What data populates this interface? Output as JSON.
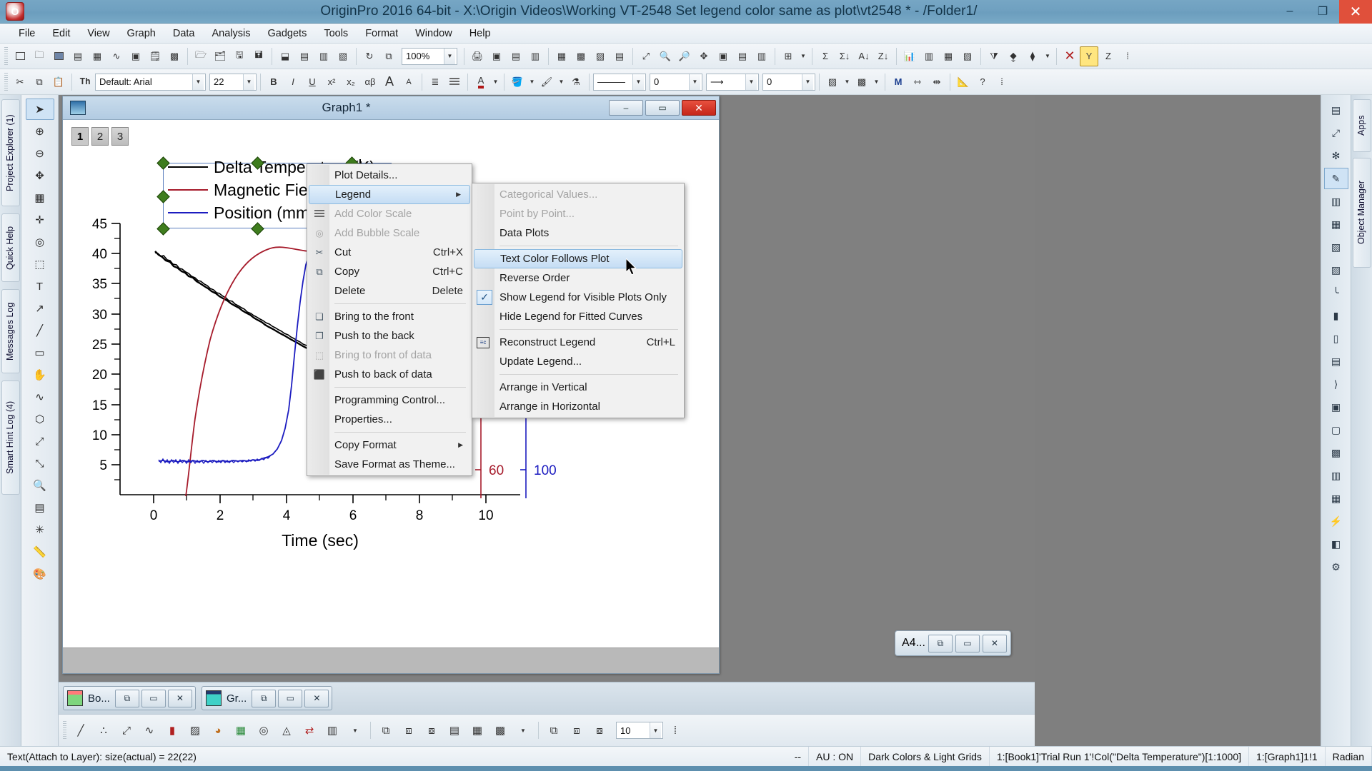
{
  "window": {
    "title": "OriginPro 2016 64-bit - X:\\Origin Videos\\Working VT-2548 Set legend color same as plot\\vt2548 * - /Folder1/",
    "minimize_label": "–",
    "maximize_label": "❐",
    "close_label": "✕",
    "app_icon": "origin-logo-icon"
  },
  "menubar": {
    "items": [
      "File",
      "Edit",
      "View",
      "Graph",
      "Data",
      "Analysis",
      "Gadgets",
      "Tools",
      "Format",
      "Window",
      "Help"
    ]
  },
  "toolbar_top": {
    "zoom_value": "100%",
    "icons": [
      "new-project-icon",
      "open-icon",
      "open-excel-icon",
      "import-icon",
      "import-wizard-icon",
      "save-project-icon",
      "save-template-icon",
      "print-icon",
      "print-preview-icon",
      "import-ascii-icon",
      "import-wizard2-icon",
      "import-db-icon",
      "refresh-icon",
      "rescale-icon",
      "new-layer-icon",
      "extract-icon",
      "merge-icon",
      "layer-manager-icon",
      "zoom-in-icon",
      "zoom-out-icon",
      "new-graph-icon",
      "new-matrix-icon",
      "new-excel-icon",
      "sigma-icon",
      "stat-icon",
      "sort-icon",
      "column-chart-icon",
      "bar-icon",
      "area-icon",
      "filter-icon",
      "clear-filter-icon",
      "cancel-icon",
      "yellow-y-icon",
      "z-icon"
    ]
  },
  "toolbar_format": {
    "font_name": "Default: Arial",
    "font_size": "22",
    "bold_label": "B",
    "italic_label": "I",
    "underline_label": "U",
    "superscript_label": "x²",
    "subscript_label": "x₂",
    "greek_label": "αβ",
    "increase_font_label": "A",
    "decrease_font_label": "A",
    "line_width_value": "0",
    "line_width_value2": "0",
    "units_label": "M",
    "icons": [
      "cut-icon",
      "copy-icon",
      "paste-icon",
      "font-icon",
      "align-icon",
      "columns-icon",
      "font-color-icon",
      "fill-color-icon",
      "pattern-color-icon",
      "highlight-icon",
      "eyedropper-icon",
      "line-style-icon",
      "arrow-style-icon",
      "hatch-icon",
      "measure-icon",
      "help-icon"
    ]
  },
  "left_dock": {
    "tabs": [
      "Project Explorer (1)",
      "Quick Help",
      "Messages Log",
      "Smart Hint Log (4)"
    ]
  },
  "right_dock": {
    "tabs": [
      "Apps",
      "Object Manager"
    ]
  },
  "graph_window": {
    "title": "Graph1 *",
    "icon": "graph-window-icon",
    "minimize_label": "–",
    "restore_label": "▭",
    "close_label": "✕",
    "layer_tabs": [
      "1",
      "2",
      "3"
    ]
  },
  "chart_data": {
    "type": "line",
    "title": "",
    "xlabel": "Time (sec)",
    "ylabel": "",
    "xlim": [
      -0.6,
      11.2
    ],
    "ylim": [
      3.2,
      46.5
    ],
    "xticks": [
      0,
      2,
      4,
      6,
      8,
      10
    ],
    "yticks": [
      5,
      10,
      15,
      20,
      25,
      30,
      35,
      40,
      45
    ],
    "grid": false,
    "legend_position": "top-center",
    "extra_right_axes": [
      {
        "label": "60",
        "color": "#a61b2b"
      },
      {
        "label": "100",
        "color": "#1c1cc0"
      }
    ],
    "series": [
      {
        "name": "Delta Temperature (K)",
        "color": "#000000",
        "unit": "K",
        "description": "Noisy monotonically decreasing curve from ~40 at t=0.6 to ~15 at t=10",
        "x": [
          0.6,
          1.0,
          1.5,
          2.0,
          2.5,
          3.0,
          3.5,
          4.0,
          4.5,
          5.0,
          5.5,
          6.0,
          6.5,
          7.0,
          7.5,
          8.0,
          8.5,
          9.0,
          9.5,
          10.0
        ],
        "y": [
          40.2,
          38.6,
          36.5,
          34.6,
          32.7,
          31.0,
          29.5,
          28.0,
          26.6,
          25.4,
          24.2,
          23.0,
          22.0,
          21.0,
          20.0,
          19.0,
          18.1,
          17.2,
          16.2,
          15.3
        ]
      },
      {
        "name": "Magnetic Field (G)",
        "color": "#a61b2b",
        "unit": "G",
        "description": "Exponential rise saturating at ~40.5",
        "x": [
          1.0,
          1.3,
          1.6,
          2.0,
          2.4,
          2.8,
          3.2,
          3.6,
          4.0,
          4.5,
          5.0,
          6.0,
          7.0,
          8.0,
          9.0,
          10.0
        ],
        "y": [
          4.0,
          9.0,
          15.0,
          22.0,
          27.5,
          31.5,
          34.5,
          36.8,
          38.3,
          39.6,
          40.1,
          40.5,
          40.5,
          40.5,
          40.5,
          40.5
        ]
      },
      {
        "name": "Position (mm)",
        "color": "#1c1cc0",
        "unit": "mm",
        "description": "Flat noisy baseline near 6 until t~3.5, then rises to peak ~41.5 at t=4.4, then falls",
        "x": [
          0.7,
          1.2,
          1.8,
          2.4,
          3.0,
          3.3,
          3.6,
          3.8,
          4.0,
          4.2,
          4.4,
          4.6,
          4.8,
          5.0,
          5.2,
          5.4,
          5.6
        ],
        "y": [
          6.1,
          6.0,
          6.2,
          6.1,
          6.6,
          7.6,
          10.5,
          15.0,
          22.5,
          33.0,
          41.3,
          41.0,
          38.0,
          31.0,
          25.5,
          22.0,
          21.5
        ]
      }
    ]
  },
  "legend": {
    "entries": [
      {
        "label": "Delta Temperature (K)",
        "color": "#000000"
      },
      {
        "label": "Magnetic Field (G)",
        "color": "#a61b2b"
      },
      {
        "label": "Position (mm)",
        "color": "#1c1cc0"
      }
    ]
  },
  "context_menu": {
    "items": [
      {
        "label": "Plot Details...",
        "icon": "",
        "shortcut": "",
        "disabled": false,
        "submenu": false,
        "highlighted": false
      },
      {
        "label": "Legend",
        "icon": "",
        "shortcut": "",
        "disabled": false,
        "submenu": true,
        "highlighted": true
      },
      {
        "label": "Add Color Scale",
        "icon": "color-scale-icon",
        "shortcut": "",
        "disabled": true,
        "submenu": false,
        "highlighted": false
      },
      {
        "label": "Add Bubble Scale",
        "icon": "bubble-scale-icon",
        "shortcut": "",
        "disabled": true,
        "submenu": false,
        "highlighted": false
      },
      {
        "label": "Cut",
        "icon": "scissors-icon",
        "shortcut": "Ctrl+X",
        "disabled": false,
        "submenu": false,
        "highlighted": false
      },
      {
        "label": "Copy",
        "icon": "copy-icon",
        "shortcut": "Ctrl+C",
        "disabled": false,
        "submenu": false,
        "highlighted": false
      },
      {
        "label": "Delete",
        "icon": "",
        "shortcut": "Delete",
        "disabled": false,
        "submenu": false,
        "highlighted": false
      },
      {
        "separator": true
      },
      {
        "label": "Bring to the front",
        "icon": "bring-front-icon",
        "shortcut": "",
        "disabled": false,
        "submenu": false,
        "highlighted": false
      },
      {
        "label": "Push to the back",
        "icon": "push-back-icon",
        "shortcut": "",
        "disabled": false,
        "submenu": false,
        "highlighted": false
      },
      {
        "label": "Bring to front of data",
        "icon": "bring-front-data-icon",
        "shortcut": "",
        "disabled": true,
        "submenu": false,
        "highlighted": false
      },
      {
        "label": "Push to back of data",
        "icon": "push-back-data-icon",
        "shortcut": "",
        "disabled": false,
        "submenu": false,
        "highlighted": false
      },
      {
        "separator": true
      },
      {
        "label": "Programming Control...",
        "icon": "",
        "shortcut": "",
        "disabled": false,
        "submenu": false,
        "highlighted": false
      },
      {
        "label": "Properties...",
        "icon": "",
        "shortcut": "",
        "disabled": false,
        "submenu": false,
        "highlighted": false
      },
      {
        "separator": true
      },
      {
        "label": "Copy Format",
        "icon": "",
        "shortcut": "",
        "disabled": false,
        "submenu": true,
        "highlighted": false
      },
      {
        "label": "Save Format as Theme...",
        "icon": "",
        "shortcut": "",
        "disabled": false,
        "submenu": false,
        "highlighted": false
      }
    ]
  },
  "legend_submenu": {
    "items": [
      {
        "label": "Categorical Values...",
        "icon": "",
        "shortcut": "",
        "disabled": true,
        "checked": false,
        "highlighted": false
      },
      {
        "label": "Point by Point...",
        "icon": "",
        "shortcut": "",
        "disabled": true,
        "checked": false,
        "highlighted": false
      },
      {
        "label": "Data Plots",
        "icon": "",
        "shortcut": "",
        "disabled": false,
        "checked": false,
        "highlighted": false
      },
      {
        "separator": true
      },
      {
        "label": "Text Color Follows Plot",
        "icon": "",
        "shortcut": "",
        "disabled": false,
        "checked": false,
        "highlighted": true
      },
      {
        "label": "Reverse Order",
        "icon": "",
        "shortcut": "",
        "disabled": false,
        "checked": false,
        "highlighted": false
      },
      {
        "label": "Show Legend for Visible Plots Only",
        "icon": "",
        "shortcut": "",
        "disabled": false,
        "checked": true,
        "highlighted": false
      },
      {
        "label": "Hide Legend for Fitted Curves",
        "icon": "",
        "shortcut": "",
        "disabled": false,
        "checked": false,
        "highlighted": false
      },
      {
        "separator": true
      },
      {
        "label": "Reconstruct Legend",
        "icon": "reconstruct-legend-icon",
        "shortcut": "Ctrl+L",
        "disabled": false,
        "checked": false,
        "highlighted": false
      },
      {
        "label": "Update Legend...",
        "icon": "",
        "shortcut": "",
        "disabled": false,
        "checked": false,
        "highlighted": false
      },
      {
        "separator": true
      },
      {
        "label": "Arrange in Vertical",
        "icon": "",
        "shortcut": "",
        "disabled": false,
        "checked": false,
        "highlighted": false
      },
      {
        "label": "Arrange in Horizontal",
        "icon": "",
        "shortcut": "",
        "disabled": false,
        "checked": false,
        "highlighted": false
      }
    ]
  },
  "window_tabs": [
    {
      "label": "Bo...",
      "icon": "workbook-icon"
    },
    {
      "label": "Gr...",
      "icon": "graph-icon"
    }
  ],
  "float_tab": {
    "label": "A4...",
    "icon": "workbook-icon"
  },
  "bottom_toolbar": {
    "spin_value": "10",
    "icons": [
      "line-icon",
      "scatter-icon",
      "line-symbol-icon",
      "column-icon",
      "area-icon",
      "pie-icon",
      "contour-icon",
      "polar-icon",
      "ternary-icon",
      "image-icon",
      "bubble-icon",
      "vector-icon",
      "waterfall-icon",
      "3dbar-icon",
      "stack-icon",
      "layout-icon",
      "merge-icon",
      "extract-icon",
      "copy-page-icon",
      "clone-icon"
    ]
  },
  "statusbar": {
    "message": "Text(Attach to Layer): size(actual) = 22(22)",
    "cells": [
      "--",
      "AU : ON",
      "Dark Colors & Light Grids",
      "1:[Book1]'Trial Run 1'!Col(\"Delta Temperature\")[1:1000]",
      "1:[Graph1]1!1",
      "Radian"
    ]
  },
  "colors": {
    "title_bar": "#6fa0c0",
    "series_black": "#000000",
    "series_red": "#a61b2b",
    "series_blue": "#1c1cc0",
    "highlight": "#c5ddf4",
    "handle_green": "#3f7d1e"
  }
}
